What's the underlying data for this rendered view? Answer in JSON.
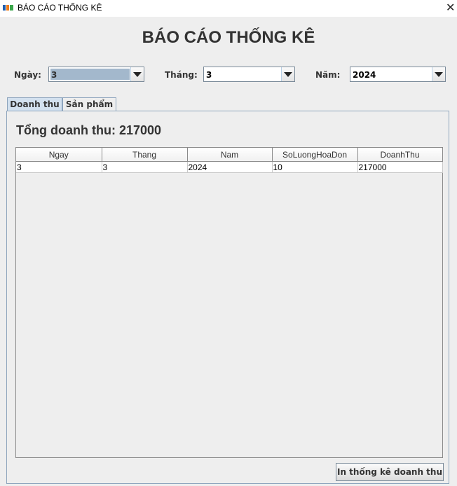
{
  "window": {
    "title": "BÁO CÁO THỐNG KÊ",
    "close_glyph": "✕"
  },
  "page": {
    "heading": "BÁO CÁO THỐNG KÊ"
  },
  "filters": {
    "day": {
      "label": "Ngày:",
      "value": "3"
    },
    "month": {
      "label": "Tháng:",
      "value": "3"
    },
    "year": {
      "label": "Năm:",
      "value": "2024"
    }
  },
  "tabs": [
    {
      "label": "Doanh thu",
      "active": true
    },
    {
      "label": "Sản phẩm",
      "active": false
    }
  ],
  "revenue": {
    "total_text": "Tổng doanh thu: 217000",
    "table": {
      "columns": [
        "Ngay",
        "Thang",
        "Nam",
        "SoLuongHoaDon",
        "DoanhThu"
      ],
      "rows": [
        [
          "3",
          "3",
          "2024",
          "10",
          "217000"
        ]
      ]
    },
    "print_button": "In thống kê doanh thu"
  },
  "colors": {
    "selected_combo_bg": "#a3b8cc",
    "active_tab_bg": "#d3e1ef",
    "border": "#8ea5bd"
  },
  "icons": {
    "app": "fpt-logo-icon",
    "close": "close-icon",
    "dropdown": "chevron-down-icon"
  }
}
